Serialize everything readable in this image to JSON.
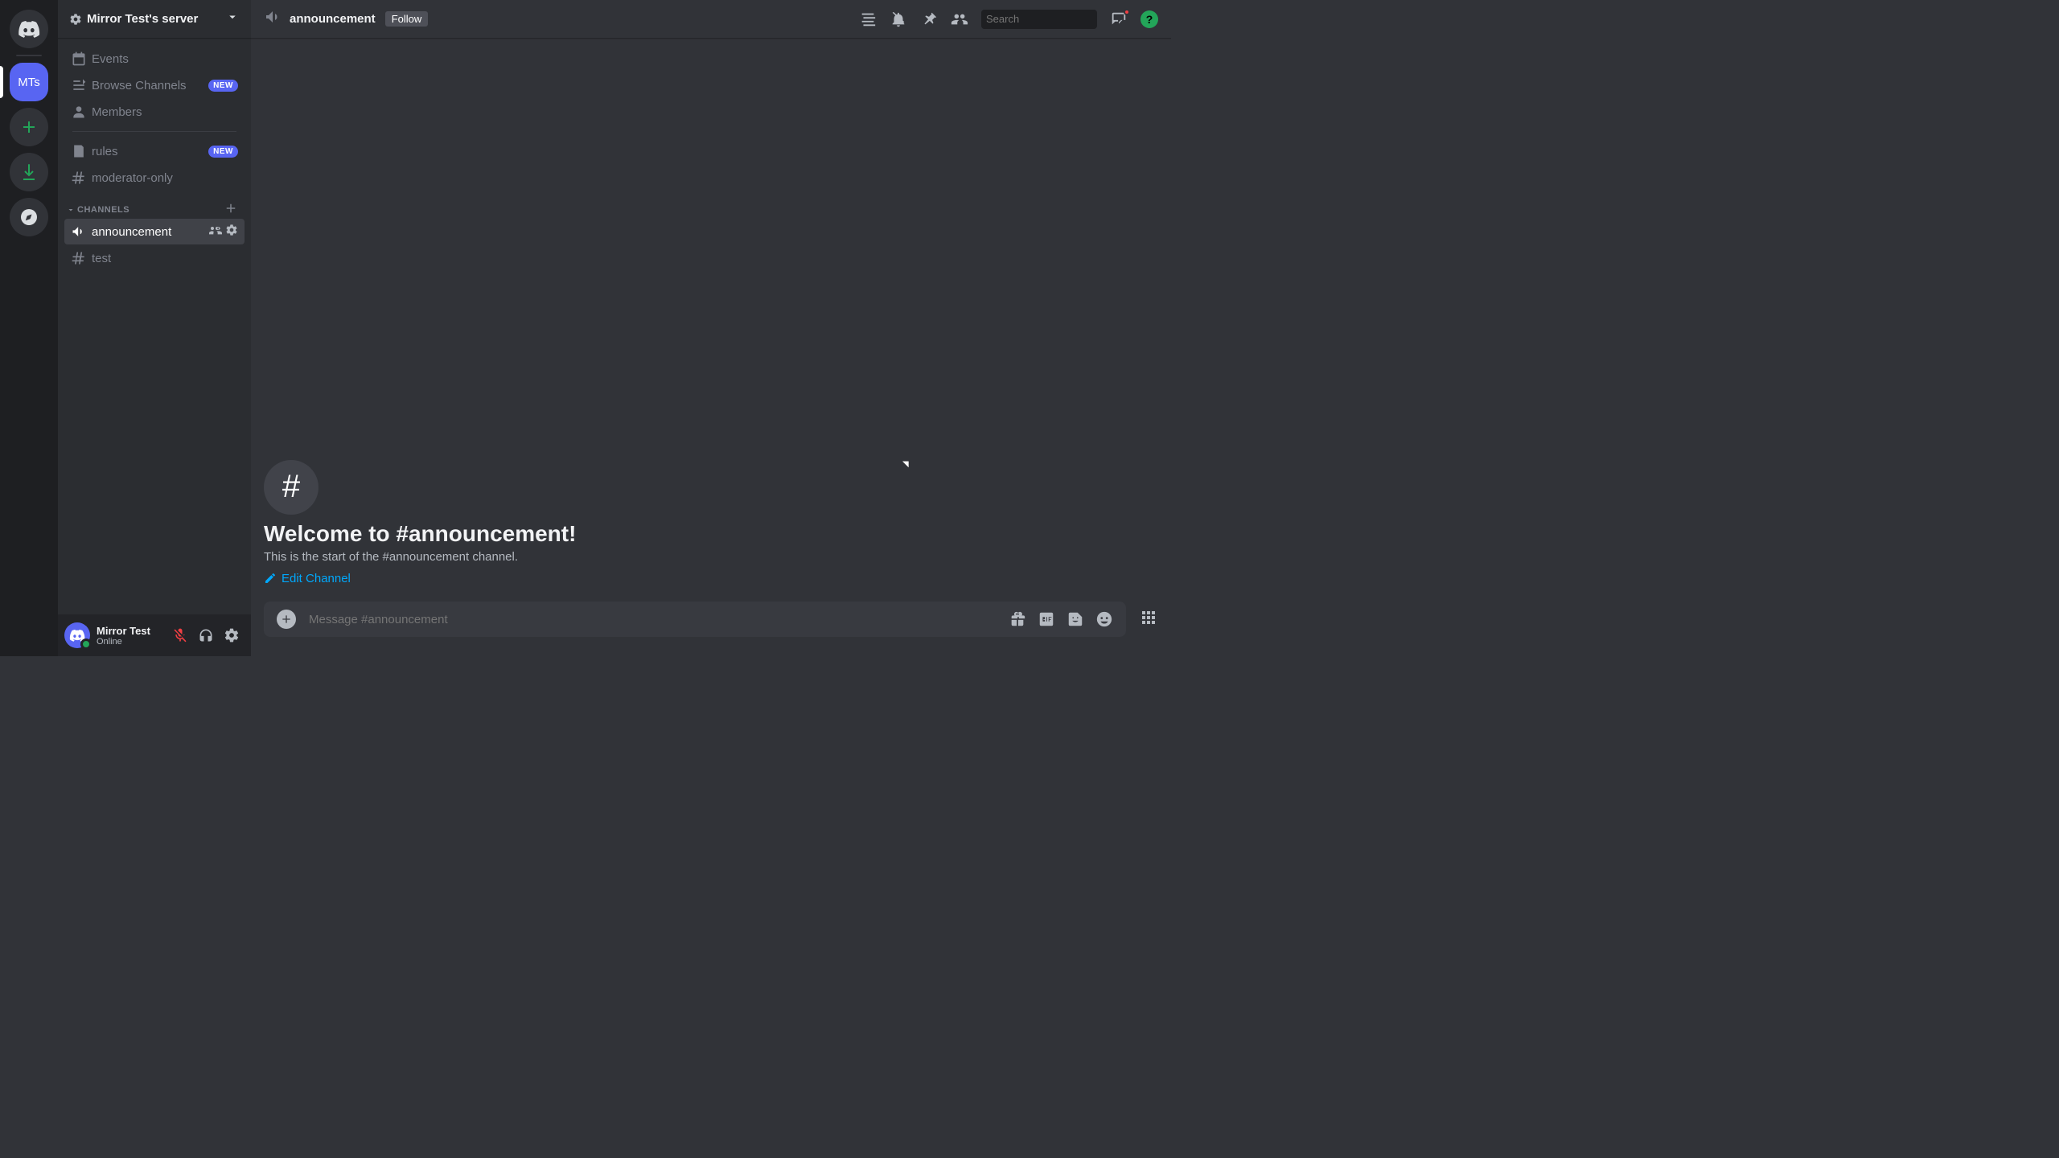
{
  "serverList": {
    "selectedInitials": "MTs"
  },
  "server": {
    "name": "Mirror Test's server"
  },
  "sidebar": {
    "events": "Events",
    "browse": "Browse Channels",
    "browseBadge": "NEW",
    "members": "Members",
    "rules": "rules",
    "rulesBadge": "NEW",
    "modOnly": "moderator-only",
    "categoryLabel": "CHANNELS",
    "announcement": "announcement",
    "test": "test"
  },
  "userPanel": {
    "name": "Mirror Test",
    "status": "Online"
  },
  "header": {
    "channelName": "announcement",
    "followLabel": "Follow",
    "searchPlaceholder": "Search"
  },
  "welcome": {
    "title": "Welcome to #announcement!",
    "subtitle": "This is the start of the #announcement channel.",
    "editLabel": "Edit Channel"
  },
  "composer": {
    "placeholder": "Message #announcement"
  }
}
